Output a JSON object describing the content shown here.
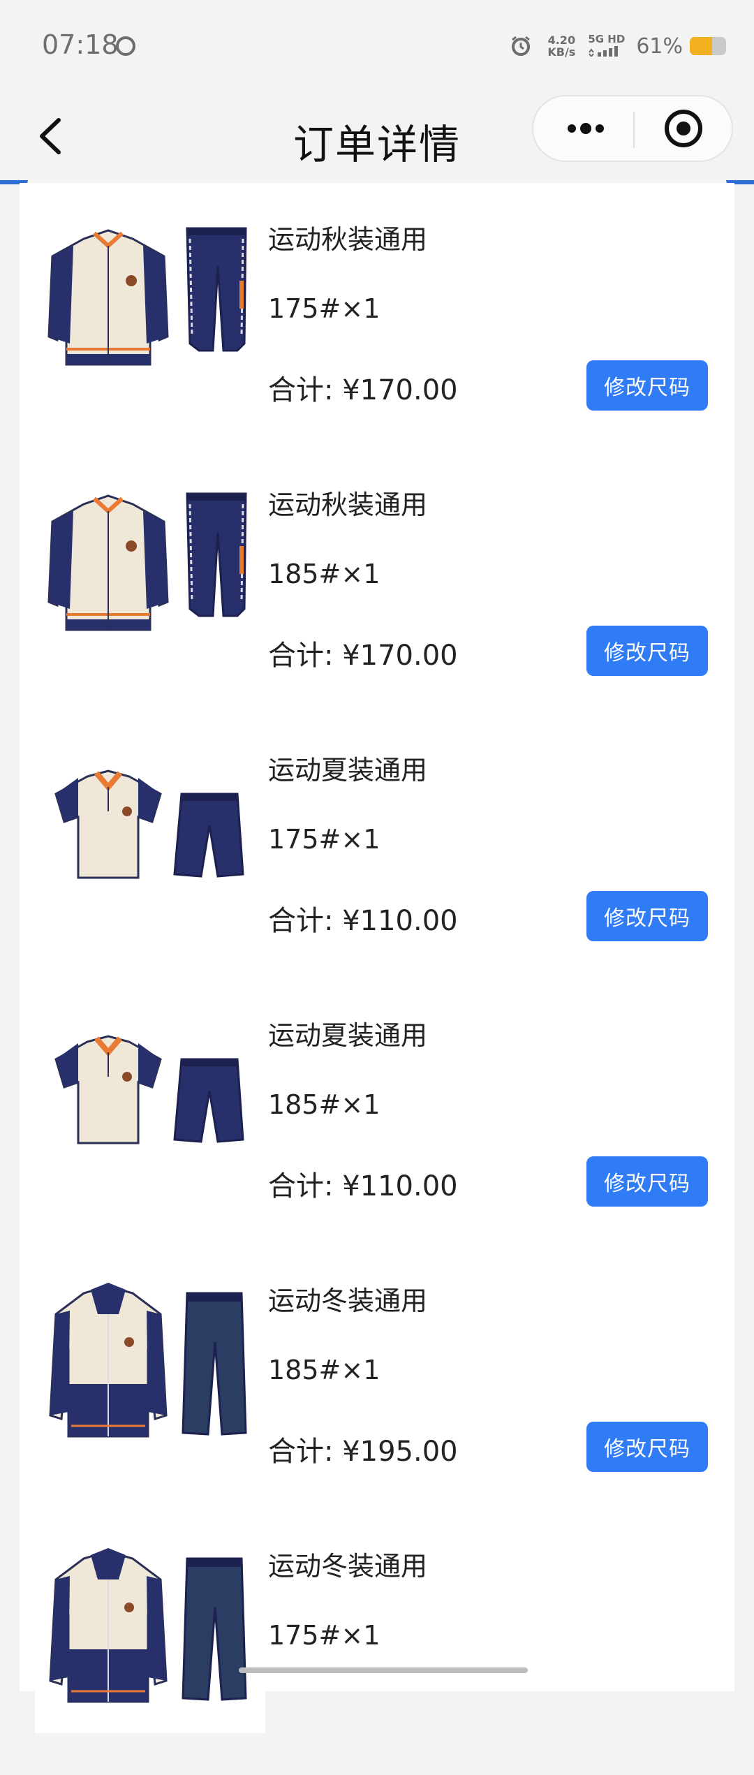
{
  "status_bar": {
    "time": "07:18",
    "net_speed_value": "4.20",
    "net_speed_unit": "KB/s",
    "signal_label": "5G HD",
    "battery_percent": "61%",
    "battery_level": 0.61,
    "battery_color": "#f2b01e"
  },
  "nav": {
    "title": "订单详情",
    "back_icon": "chevron-left-icon",
    "more_icon": "more-dots-icon",
    "close_icon": "target-close-icon"
  },
  "accent_color": "#2f7cf6",
  "items": [
    {
      "name": "运动秋装通用",
      "size": "175#×1",
      "total": "合计: ¥170.00",
      "button": "修改尺码",
      "garment": "autumn"
    },
    {
      "name": "运动秋装通用",
      "size": "185#×1",
      "total": "合计: ¥170.00",
      "button": "修改尺码",
      "garment": "autumn"
    },
    {
      "name": "运动夏装通用",
      "size": "175#×1",
      "total": "合计: ¥110.00",
      "button": "修改尺码",
      "garment": "summer"
    },
    {
      "name": "运动夏装通用",
      "size": "185#×1",
      "total": "合计: ¥110.00",
      "button": "修改尺码",
      "garment": "summer"
    },
    {
      "name": "运动冬装通用",
      "size": "185#×1",
      "total": "合计: ¥195.00",
      "button": "修改尺码",
      "garment": "winter"
    },
    {
      "name": "运动冬装通用",
      "size": "175#×1",
      "total": "",
      "button": "",
      "garment": "winter"
    }
  ]
}
